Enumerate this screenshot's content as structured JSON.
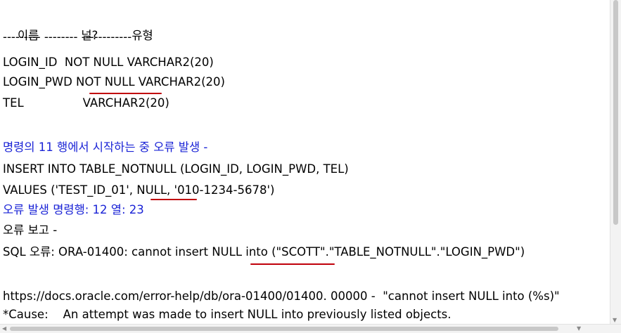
{
  "output": {
    "header": {
      "name": "이름",
      "null": "널?",
      "type": "유형"
    },
    "separator": "--------- -------- ------------",
    "columns": [
      "LOGIN_ID  NOT NULL VARCHAR2(20)",
      "LOGIN_PWD NOT NULL VARCHAR2(20)",
      "TEL                VARCHAR2(20)"
    ],
    "error_start": "명령의 11 행에서 시작하는 중 오류 발생 -",
    "insert_line": "INSERT INTO TABLE_NOTNULL (LOGIN_ID, LOGIN_PWD, TEL)",
    "values_line": "VALUES ('TEST_ID_01', NULL, '010-1234-5678')",
    "error_position": "오류 발생 명령행: 12 열: 23",
    "error_report": "오류 보고 -",
    "sql_error": "SQL 오류: ORA-01400: cannot insert NULL into (\"SCOTT\".\"TABLE_NOTNULL\".\"LOGIN_PWD\")",
    "help_url": "https://docs.oracle.com/error-help/db/ora-01400/01400. 00000 -  \"cannot insert NULL into (%s)\"",
    "cause": "*Cause:    An attempt was made to insert NULL into previously listed objects."
  },
  "colors": {
    "info_text": "#1a23d6",
    "highlight_underline": "#c0000a"
  }
}
